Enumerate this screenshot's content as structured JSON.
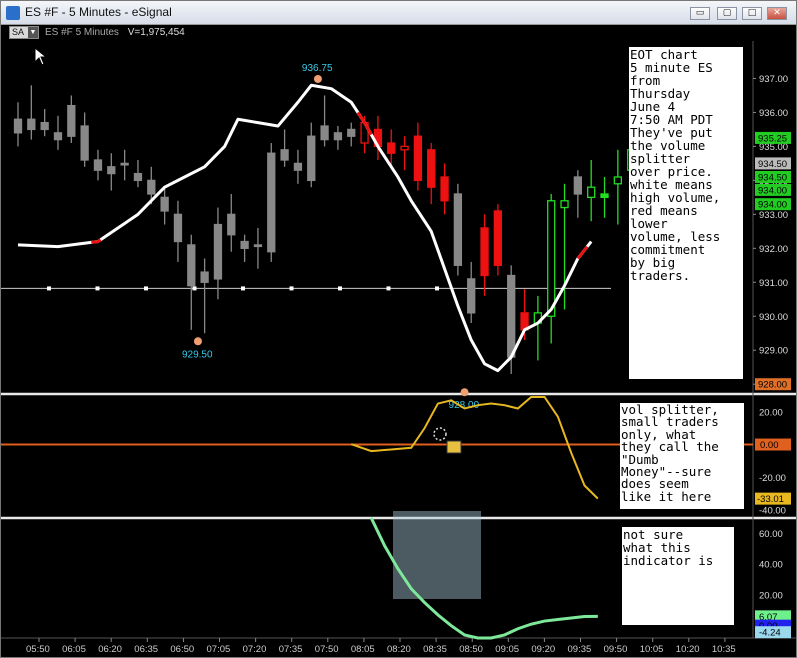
{
  "window": {
    "title": "ES #F - 5 Minutes - eSignal",
    "minimize_label": "▭",
    "restore_label": "▢",
    "maximize_label": "□",
    "close_label": "✕"
  },
  "toolbar": {
    "sa_label": "SA",
    "symbol": "ES #F",
    "interval": "5 Minutes",
    "volume": "V=1,975,454"
  },
  "price_panel": {
    "ylim": [
      927.8,
      937.75
    ],
    "ticks": [
      "937.00",
      "936.00",
      "935.00",
      "934.00",
      "933.00",
      "932.00",
      "931.00",
      "930.00",
      "929.00",
      "928.00"
    ],
    "tick_values": [
      937,
      936,
      935,
      934,
      933,
      932,
      931,
      930,
      929,
      928
    ],
    "last_price_labels": [
      {
        "text": "935.25",
        "value": 935.25,
        "color": "#22cc22"
      },
      {
        "text": "934.50",
        "value": 934.5,
        "color": "#bbbbbb"
      },
      {
        "text": "934.50",
        "value": 934.1,
        "color": "#22cc22"
      },
      {
        "text": "934.00",
        "value": 933.72,
        "color": "#22cc22"
      },
      {
        "text": "934.00",
        "value": 933.3,
        "color": "#22cc22"
      },
      {
        "text": "928.00",
        "value": 928.0,
        "color": "#e07028"
      }
    ],
    "high_marker": {
      "text": "936.75",
      "value": 936.75,
      "bar": 22.5
    },
    "low_marker": {
      "text": "929.50",
      "value": 929.5,
      "bar": 13.5
    },
    "low2_marker": {
      "text": "928.00",
      "value": 928.0,
      "bar": 33.5
    },
    "hline_value": 930.82
  },
  "chart_data": {
    "type": "candlestick",
    "x_labels": [
      "05:50",
      "06:05",
      "06:20",
      "06:35",
      "06:50",
      "07:05",
      "07:20",
      "07:35",
      "07:50",
      "08:05",
      "08:20",
      "08:35",
      "08:50",
      "09:05",
      "09:20",
      "09:35",
      "09:50",
      "10:05",
      "10:20",
      "10:35"
    ],
    "candles": [
      {
        "o": 935.8,
        "h": 936.3,
        "l": 935.0,
        "c": 935.4,
        "col": "gray"
      },
      {
        "o": 935.5,
        "h": 936.8,
        "l": 935.2,
        "c": 935.8,
        "col": "gray"
      },
      {
        "o": 935.7,
        "h": 936.1,
        "l": 935.3,
        "c": 935.5,
        "col": "gray"
      },
      {
        "o": 935.4,
        "h": 935.9,
        "l": 934.9,
        "c": 935.2,
        "col": "gray"
      },
      {
        "o": 935.3,
        "h": 936.5,
        "l": 935.1,
        "c": 936.2,
        "col": "gray"
      },
      {
        "o": 935.6,
        "h": 936.0,
        "l": 934.4,
        "c": 934.6,
        "col": "gray"
      },
      {
        "o": 934.6,
        "h": 934.9,
        "l": 934.0,
        "c": 934.3,
        "col": "gray"
      },
      {
        "o": 934.4,
        "h": 934.8,
        "l": 933.7,
        "c": 934.2,
        "col": "gray"
      },
      {
        "o": 934.5,
        "h": 934.9,
        "l": 934.0,
        "c": 934.5,
        "col": "gray"
      },
      {
        "o": 934.2,
        "h": 934.6,
        "l": 933.8,
        "c": 934.0,
        "col": "gray"
      },
      {
        "o": 934.0,
        "h": 934.4,
        "l": 933.3,
        "c": 933.6,
        "col": "gray"
      },
      {
        "o": 933.5,
        "h": 933.8,
        "l": 932.7,
        "c": 933.1,
        "col": "gray"
      },
      {
        "o": 933.0,
        "h": 933.4,
        "l": 931.6,
        "c": 932.2,
        "col": "gray"
      },
      {
        "o": 932.1,
        "h": 932.4,
        "l": 929.6,
        "c": 930.9,
        "col": "gray"
      },
      {
        "o": 931.3,
        "h": 931.7,
        "l": 929.5,
        "c": 931.0,
        "col": "gray"
      },
      {
        "o": 932.7,
        "h": 933.2,
        "l": 930.5,
        "c": 931.1,
        "col": "gray"
      },
      {
        "o": 932.4,
        "h": 933.6,
        "l": 931.9,
        "c": 933.0,
        "col": "gray"
      },
      {
        "o": 932.0,
        "h": 932.4,
        "l": 931.6,
        "c": 932.2,
        "col": "gray"
      },
      {
        "o": 932.1,
        "h": 932.6,
        "l": 931.4,
        "c": 932.1,
        "col": "gray"
      },
      {
        "o": 931.9,
        "h": 935.1,
        "l": 931.6,
        "c": 934.8,
        "col": "gray"
      },
      {
        "o": 934.9,
        "h": 935.5,
        "l": 934.4,
        "c": 934.6,
        "col": "gray"
      },
      {
        "o": 934.5,
        "h": 934.9,
        "l": 933.9,
        "c": 934.3,
        "col": "gray"
      },
      {
        "o": 934.0,
        "h": 935.7,
        "l": 933.8,
        "c": 935.3,
        "col": "gray"
      },
      {
        "o": 935.6,
        "h": 936.5,
        "l": 935.0,
        "c": 935.2,
        "col": "gray"
      },
      {
        "o": 935.2,
        "h": 935.6,
        "l": 934.9,
        "c": 935.4,
        "col": "gray"
      },
      {
        "o": 935.3,
        "h": 935.7,
        "l": 935.0,
        "c": 935.5,
        "col": "gray"
      },
      {
        "o": 935.1,
        "h": 935.9,
        "l": 934.8,
        "c": 935.7,
        "col": "red"
      },
      {
        "o": 935.5,
        "h": 935.9,
        "l": 934.6,
        "c": 935.0,
        "col": "red"
      },
      {
        "o": 935.1,
        "h": 935.5,
        "l": 934.4,
        "c": 934.8,
        "col": "red"
      },
      {
        "o": 934.9,
        "h": 935.3,
        "l": 934.3,
        "c": 935.0,
        "col": "red"
      },
      {
        "o": 935.3,
        "h": 935.7,
        "l": 933.7,
        "c": 934.0,
        "col": "red"
      },
      {
        "o": 934.9,
        "h": 935.1,
        "l": 933.3,
        "c": 933.8,
        "col": "red"
      },
      {
        "o": 934.1,
        "h": 934.5,
        "l": 933.0,
        "c": 933.4,
        "col": "red"
      },
      {
        "o": 933.6,
        "h": 933.9,
        "l": 931.2,
        "c": 931.5,
        "col": "gray"
      },
      {
        "o": 931.1,
        "h": 931.6,
        "l": 929.8,
        "c": 930.1,
        "col": "gray"
      },
      {
        "o": 932.6,
        "h": 933.0,
        "l": 930.6,
        "c": 931.2,
        "col": "red"
      },
      {
        "o": 933.1,
        "h": 933.3,
        "l": 931.2,
        "c": 931.5,
        "col": "red"
      },
      {
        "o": 931.2,
        "h": 931.5,
        "l": 928.3,
        "c": 928.8,
        "col": "gray"
      },
      {
        "o": 930.1,
        "h": 930.8,
        "l": 929.3,
        "c": 929.6,
        "col": "red"
      },
      {
        "o": 929.8,
        "h": 930.6,
        "l": 928.7,
        "c": 930.1,
        "col": "green"
      },
      {
        "o": 930.0,
        "h": 933.6,
        "l": 929.2,
        "c": 933.4,
        "col": "green"
      },
      {
        "o": 933.2,
        "h": 933.9,
        "l": 930.2,
        "c": 933.4,
        "col": "green"
      },
      {
        "o": 933.6,
        "h": 934.3,
        "l": 932.9,
        "c": 934.1,
        "col": "gray"
      },
      {
        "o": 933.5,
        "h": 934.6,
        "l": 932.8,
        "c": 933.8,
        "col": "green"
      },
      {
        "o": 933.6,
        "h": 934.1,
        "l": 932.9,
        "c": 933.5,
        "col": "green"
      },
      {
        "o": 933.9,
        "h": 934.9,
        "l": 932.7,
        "c": 934.1,
        "col": "green"
      },
      {
        "o": 934.3,
        "h": 935.4,
        "l": 933.5,
        "c": 934.9,
        "col": "green"
      }
    ],
    "price_line": [
      [
        0,
        932.1
      ],
      [
        3,
        932.05
      ],
      [
        6,
        932.2
      ],
      [
        9,
        933.0
      ],
      [
        11,
        933.8
      ],
      [
        12,
        934.0
      ],
      [
        14,
        934.4
      ],
      [
        15.5,
        935.0
      ],
      [
        16.5,
        935.8
      ],
      [
        18,
        935.7
      ],
      [
        19.5,
        935.6
      ],
      [
        21,
        936.3
      ],
      [
        22,
        936.8
      ],
      [
        23.5,
        936.7
      ],
      [
        25,
        936.3
      ],
      [
        26,
        935.7
      ],
      [
        27,
        935.0
      ],
      [
        28.5,
        934.1
      ],
      [
        29.5,
        933.4
      ],
      [
        31,
        932.5
      ],
      [
        32,
        931.4
      ],
      [
        33,
        930.3
      ],
      [
        34,
        929.3
      ],
      [
        35,
        928.6
      ],
      [
        36,
        928.4
      ],
      [
        37,
        928.8
      ],
      [
        38,
        929.6
      ],
      [
        39,
        929.8
      ],
      [
        40,
        930.2
      ],
      [
        41,
        930.9
      ],
      [
        42,
        931.7
      ],
      [
        43,
        932.2
      ]
    ],
    "price_line_red_segments": [
      [
        5.5,
        6.2
      ],
      [
        25.5,
        26.5
      ],
      [
        42,
        42.7
      ]
    ],
    "vol_splitter": {
      "label": "vol splitter",
      "ylim": [
        -43,
        29
      ],
      "ticks": [
        "20.00",
        "0.00",
        "-20.00",
        "-40.00"
      ],
      "tick_values": [
        20,
        0,
        -20,
        -40
      ],
      "last_label": "-33.01",
      "last_value": -33.01,
      "zero_label": "0.00",
      "points": [
        [
          25,
          0.2
        ],
        [
          26.5,
          -4
        ],
        [
          28,
          -3
        ],
        [
          29.5,
          -2
        ],
        [
          30.5,
          10
        ],
        [
          31.5,
          25
        ],
        [
          32.5,
          27
        ],
        [
          33.5,
          22
        ],
        [
          34.5,
          24
        ],
        [
          35.5,
          25
        ],
        [
          36.5,
          24
        ],
        [
          37.5,
          22
        ],
        [
          38.5,
          29
        ],
        [
          39.5,
          29
        ],
        [
          40.5,
          17
        ],
        [
          41.5,
          -5
        ],
        [
          42.5,
          -25
        ],
        [
          43.5,
          -33.01
        ]
      ]
    },
    "indicator3": {
      "ylim": [
        -8,
        68
      ],
      "ticks": [
        "60.00",
        "40.00",
        "20.00"
      ],
      "tick_values": [
        60,
        40,
        20
      ],
      "labels": [
        {
          "text": "6.07",
          "value": 6.07,
          "color": "#6ef08a"
        },
        {
          "text": "0.00",
          "value": 0,
          "color": "#2222ee"
        },
        {
          "text": "-4.24",
          "value": -4.24,
          "color": "#9ad8ee"
        }
      ],
      "points": [
        [
          26.5,
          70
        ],
        [
          27.5,
          52
        ],
        [
          28.5,
          37
        ],
        [
          29.5,
          24
        ],
        [
          30.5,
          15
        ],
        [
          31.5,
          7
        ],
        [
          32.5,
          0
        ],
        [
          33.5,
          -6
        ],
        [
          34.5,
          -8
        ],
        [
          35.5,
          -8
        ],
        [
          36.5,
          -6
        ],
        [
          37.5,
          -2
        ],
        [
          38.5,
          1
        ],
        [
          39.5,
          3
        ],
        [
          40.5,
          4
        ],
        [
          41.5,
          5
        ],
        [
          42.5,
          6
        ],
        [
          43.5,
          6.07
        ]
      ]
    }
  },
  "notes": {
    "note1": "EOT chart\n5 minute ES\nfrom\nThursday\nJune 4\n7:50 AM PDT\nThey've put\nthe volume\nsplitter\nover price.\nwhite means\nhigh volume,\nred means\nlower\nvolume, less\ncommitment\nby big\ntraders.",
    "note2": "vol splitter,\nsmall traders\nonly, what\nthey call the\n\"Dumb\nMoney\"--sure\ndoes seem\nlike it here",
    "note3": "not sure\nwhat this\nindicator is"
  },
  "colors": {
    "up": "#22dd22",
    "down": "#ee1111",
    "neutral": "#888888",
    "price_line": "#ffffff",
    "vol_line": "#e8b820",
    "ind_line": "#7ee89a",
    "zero_line": "#e06020",
    "marker": "#f0a070",
    "marker_text": "#38c8e8"
  }
}
